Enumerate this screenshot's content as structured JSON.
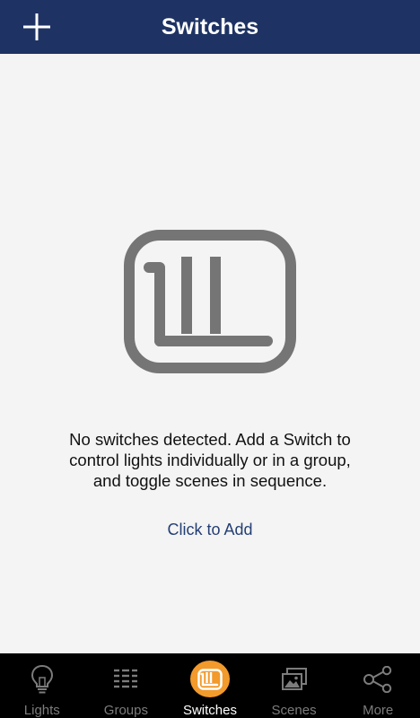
{
  "header": {
    "title": "Switches",
    "add_icon": "plus-icon",
    "background_color": "#1e3363"
  },
  "empty_state": {
    "illustration_icon": "switch-device-icon",
    "message": "No switches detected. Add a Switch to control lights individually or in a group, and toggle scenes in sequence.",
    "message_lines": [
      "No switches detected. Add a Switch to",
      "control lights individually or in a group,",
      "and toggle scenes in sequence."
    ],
    "action_label": "Click to Add"
  },
  "tabbar": {
    "active_color": "#f29a2c",
    "items": [
      {
        "label": "Lights",
        "icon": "lightbulb-icon",
        "active": false
      },
      {
        "label": "Groups",
        "icon": "groups-icon",
        "active": false
      },
      {
        "label": "Switches",
        "icon": "switch-icon",
        "active": true
      },
      {
        "label": "Scenes",
        "icon": "scenes-icon",
        "active": false
      },
      {
        "label": "More",
        "icon": "share-nodes-icon",
        "active": false
      }
    ]
  }
}
